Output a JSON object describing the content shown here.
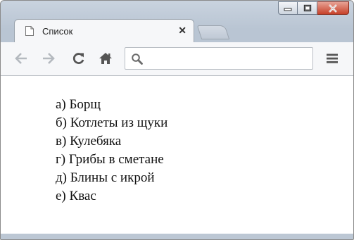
{
  "tab": {
    "title": "Список",
    "close_glyph": "✕"
  },
  "toolbar": {
    "back_icon": "arrow-left",
    "forward_icon": "arrow-right",
    "reload_icon": "reload",
    "home_icon": "home",
    "menu_icon": "hamburger"
  },
  "omnibox": {
    "value": "",
    "placeholder": ""
  },
  "list": {
    "items": [
      {
        "marker": "а)",
        "text": "Борщ"
      },
      {
        "marker": "б)",
        "text": "Котлеты из щуки"
      },
      {
        "marker": "в)",
        "text": "Кулебяка"
      },
      {
        "marker": "г)",
        "text": "Грибы в сметане"
      },
      {
        "marker": "д)",
        "text": "Блины с икрой"
      },
      {
        "marker": "е)",
        "text": "Квас"
      }
    ]
  },
  "colors": {
    "close_button": "#c7422a",
    "frame": "#b9c5d3",
    "toolbar": "#f6f7f9"
  }
}
